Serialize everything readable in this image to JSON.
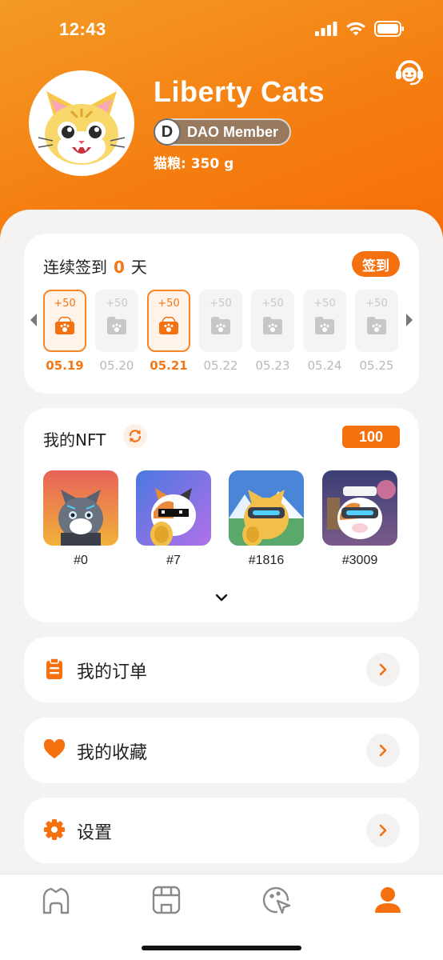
{
  "status_bar": {
    "time": "12:43"
  },
  "profile": {
    "name": "Liberty Cats",
    "badge_letter": "D",
    "badge_label": "DAO Member",
    "food_label": "猫粮:",
    "food_value": "350 g"
  },
  "checkin": {
    "title_prefix": "连续签到",
    "streak": "0",
    "title_suffix": "天",
    "button_label": "签到",
    "days": [
      {
        "points": "+50",
        "date": "05.19",
        "active": true
      },
      {
        "points": "+50",
        "date": "05.20",
        "active": false
      },
      {
        "points": "+50",
        "date": "05.21",
        "active": true
      },
      {
        "points": "+50",
        "date": "05.22",
        "active": false
      },
      {
        "points": "+50",
        "date": "05.23",
        "active": false
      },
      {
        "points": "+50",
        "date": "05.24",
        "active": false
      },
      {
        "points": "+50",
        "date": "05.25",
        "active": false
      }
    ]
  },
  "nft": {
    "title": "我的NFT",
    "count": "100",
    "items": [
      {
        "label": "#0"
      },
      {
        "label": "#7"
      },
      {
        "label": "#1816"
      },
      {
        "label": "#3009"
      }
    ]
  },
  "menu": {
    "orders": "我的订单",
    "favorites": "我的收藏",
    "settings": "设置"
  },
  "colors": {
    "accent": "#f5700f",
    "header_start": "#f49a25",
    "header_end": "#f76a08",
    "inactive_tab": "#8a8a8a"
  },
  "icons": {
    "support": "headset-icon",
    "orders": "clipboard-icon",
    "favorites": "heart-icon",
    "settings": "gear-icon",
    "tabs": [
      "home-icon",
      "store-icon",
      "discover-icon",
      "profile-icon"
    ]
  }
}
